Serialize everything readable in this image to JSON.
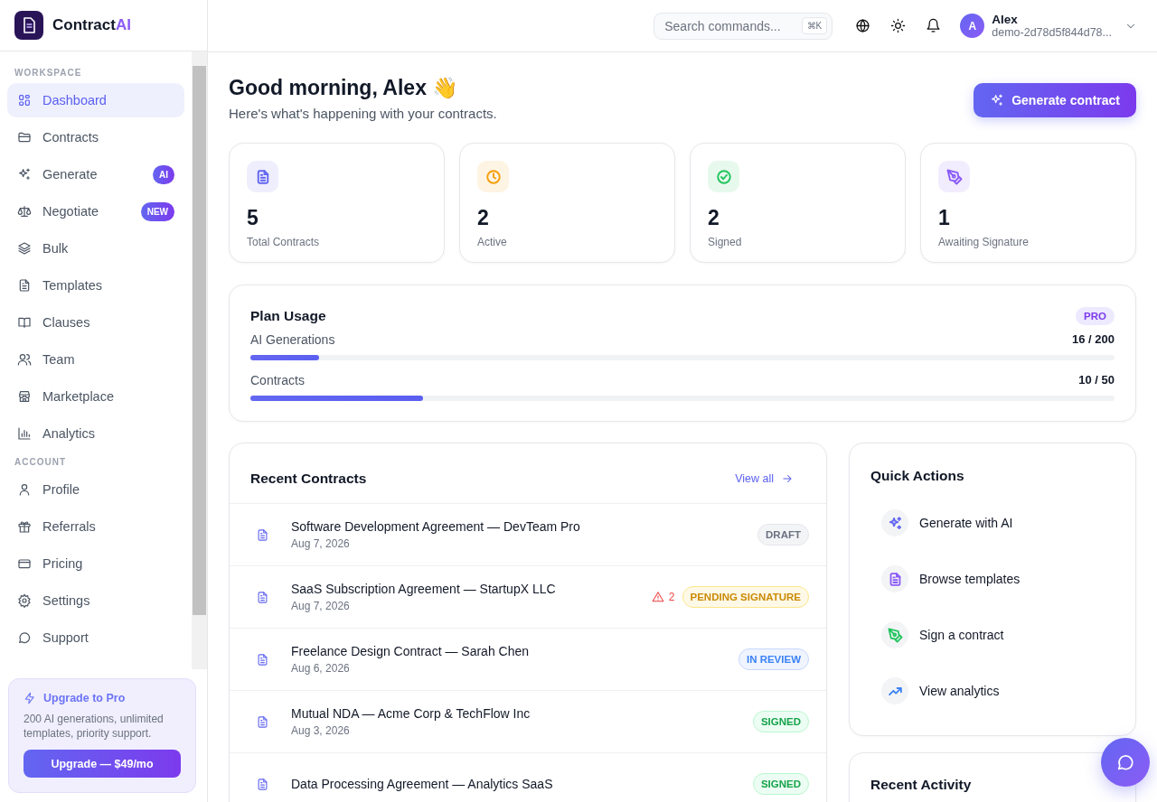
{
  "brand": {
    "name": "Contract",
    "accent": "AI"
  },
  "sidebar": {
    "sections": [
      {
        "heading": "WORKSPACE",
        "items": [
          {
            "label": "Dashboard",
            "selected": true
          },
          {
            "label": "Contracts",
            "selected": false
          },
          {
            "label": "Generate",
            "selected": false,
            "badge": "AI"
          },
          {
            "label": "Negotiate",
            "selected": false,
            "badge": "NEW"
          },
          {
            "label": "Bulk",
            "selected": false
          },
          {
            "label": "Templates",
            "selected": false
          },
          {
            "label": "Clauses",
            "selected": false
          },
          {
            "label": "Team",
            "selected": false
          },
          {
            "label": "Marketplace",
            "selected": false
          },
          {
            "label": "Analytics",
            "selected": false
          }
        ]
      },
      {
        "heading": "ACCOUNT",
        "items": [
          {
            "label": "Profile",
            "selected": false
          },
          {
            "label": "Referrals",
            "selected": false
          },
          {
            "label": "Pricing",
            "selected": false
          },
          {
            "label": "Settings",
            "selected": false
          },
          {
            "label": "Support",
            "selected": false
          }
        ]
      }
    ]
  },
  "upgrade": {
    "title": "Upgrade to Pro",
    "text": "200 AI generations, unlimited templates, priority support.",
    "button": "Upgrade — $49/mo"
  },
  "topbar": {
    "search_placeholder": "Search commands...",
    "shortcut": "⌘K",
    "user": {
      "initial": "A",
      "name": "Alex",
      "account": "demo-2d78d5f844d78..."
    }
  },
  "greeting": {
    "title": "Good morning, Alex 👋",
    "subtitle": "Here's what's happening with your contracts."
  },
  "primary_button": "Generate contract",
  "stats": [
    {
      "value": "5",
      "label": "Total Contracts",
      "color": "#6366f1"
    },
    {
      "value": "2",
      "label": "Active",
      "color": "#f59e0b"
    },
    {
      "value": "2",
      "label": "Signed",
      "color": "#22c55e"
    },
    {
      "value": "1",
      "label": "Awaiting Signature",
      "color": "#8b5cf6"
    }
  ],
  "plan": {
    "title": "Plan Usage",
    "badge": "PRO",
    "meters": [
      {
        "label": "AI Generations",
        "reading": "16 / 200",
        "level": 0.08
      },
      {
        "label": "Contracts",
        "reading": "10 / 50",
        "level": 0.2
      }
    ]
  },
  "recent": {
    "title": "Recent Contracts",
    "link": "View all",
    "rows": [
      {
        "title": "Software Development Agreement — DevTeam Pro",
        "date": "Aug 7, 2026",
        "status": "DRAFT",
        "kind": "draft"
      },
      {
        "title": "SaaS Subscription Agreement — StartupX LLC",
        "date": "Aug 7, 2026",
        "status": "PENDING SIGNATURE",
        "kind": "pending",
        "warnings": "2"
      },
      {
        "title": "Freelance Design Contract — Sarah Chen",
        "date": "Aug 6, 2026",
        "status": "IN REVIEW",
        "kind": "review"
      },
      {
        "title": "Mutual NDA — Acme Corp & TechFlow Inc",
        "date": "Aug 3, 2026",
        "status": "SIGNED",
        "kind": "signed"
      },
      {
        "title": "Data Processing Agreement — Analytics SaaS",
        "status": "SIGNED",
        "kind": "signed"
      }
    ]
  },
  "quick_actions": {
    "title": "Quick Actions",
    "items": [
      {
        "label": "Generate with AI",
        "color": "#6366f1"
      },
      {
        "label": "Browse templates",
        "color": "#8b5cf6"
      },
      {
        "label": "Sign a contract",
        "color": "#22c55e"
      },
      {
        "label": "View analytics",
        "color": "#3b82f6"
      }
    ]
  },
  "activity": {
    "title": "Recent Activity"
  }
}
